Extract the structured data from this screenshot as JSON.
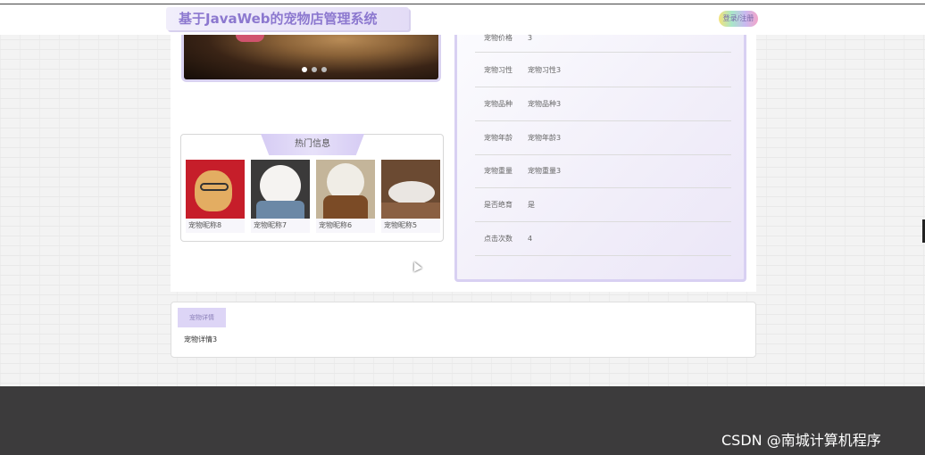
{
  "header": {
    "site_title": "基于JavaWeb的宠物店管理系统",
    "login_label": "登录/注册"
  },
  "banner": {
    "dot_count": 3,
    "active_dot": 1
  },
  "hot": {
    "title": "热门信息",
    "items": [
      {
        "name": "宠物昵称8"
      },
      {
        "name": "宠物昵称7"
      },
      {
        "name": "宠物昵称6"
      },
      {
        "name": "宠物昵称5"
      }
    ]
  },
  "info": {
    "rows": [
      {
        "label": "宠物价格",
        "value": "3"
      },
      {
        "label": "宠物习性",
        "value": "宠物习性3"
      },
      {
        "label": "宠物品种",
        "value": "宠物品种3"
      },
      {
        "label": "宠物年龄",
        "value": "宠物年龄3"
      },
      {
        "label": "宠物重量",
        "value": "宠物重量3"
      },
      {
        "label": "是否绝育",
        "value": "是"
      },
      {
        "label": "点击次数",
        "value": "4"
      }
    ]
  },
  "detail": {
    "tab_label": "宠物详情",
    "content": "宠物详情3"
  },
  "footer": {
    "watermark": "CSDN @南城计算机程序"
  },
  "colors": {
    "accent": "#8c78cf",
    "panel_border": "#d8d0f2",
    "footer_bg": "#3c3b3c"
  }
}
